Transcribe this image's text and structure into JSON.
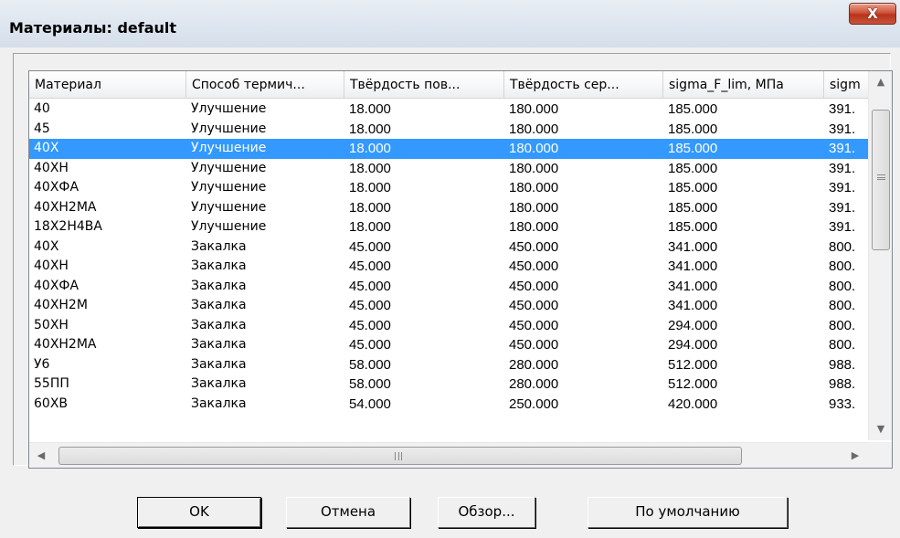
{
  "window": {
    "title": "Материалы: default",
    "close_label": "X"
  },
  "table": {
    "columns": [
      "Материал",
      "Способ термич...",
      "Твёрдость пов...",
      "Твёрдость сер...",
      "sigma_F_lim, МПа",
      "sigm"
    ],
    "selected_row": 2,
    "rows": [
      [
        "40",
        "Улучшение",
        "18.000",
        "180.000",
        "185.000",
        "391."
      ],
      [
        "45",
        "Улучшение",
        "18.000",
        "180.000",
        "185.000",
        "391."
      ],
      [
        "40Х",
        "Улучшение",
        "18.000",
        "180.000",
        "185.000",
        "391."
      ],
      [
        "40ХН",
        "Улучшение",
        "18.000",
        "180.000",
        "185.000",
        "391."
      ],
      [
        "40ХФА",
        "Улучшение",
        "18.000",
        "180.000",
        "185.000",
        "391."
      ],
      [
        "40ХН2МА",
        "Улучшение",
        "18.000",
        "180.000",
        "185.000",
        "391."
      ],
      [
        "18Х2Н4ВА",
        "Улучшение",
        "18.000",
        "180.000",
        "185.000",
        "391."
      ],
      [
        "40Х",
        "Закалка",
        "45.000",
        "450.000",
        "341.000",
        "800."
      ],
      [
        "40ХН",
        "Закалка",
        "45.000",
        "450.000",
        "341.000",
        "800."
      ],
      [
        "40ХФА",
        "Закалка",
        "45.000",
        "450.000",
        "341.000",
        "800."
      ],
      [
        "40ХН2М",
        "Закалка",
        "45.000",
        "450.000",
        "341.000",
        "800."
      ],
      [
        "50ХН",
        "Закалка",
        "45.000",
        "450.000",
        "294.000",
        "800."
      ],
      [
        "40ХН2МА",
        "Закалка",
        "45.000",
        "450.000",
        "294.000",
        "800."
      ],
      [
        "У6",
        "Закалка",
        "58.000",
        "280.000",
        "512.000",
        "988."
      ],
      [
        "55ПП",
        "Закалка",
        "58.000",
        "280.000",
        "512.000",
        "988."
      ],
      [
        "60ХВ",
        "Закалка",
        "54.000",
        "250.000",
        "420.000",
        "933."
      ]
    ]
  },
  "buttons": {
    "ok": "OK",
    "cancel": "Отмена",
    "browse": "Обзор...",
    "default": "По умолчанию"
  },
  "icons": {
    "scroll_up": "▲",
    "scroll_down": "▼",
    "scroll_left": "◀",
    "scroll_right": "▶"
  },
  "colors": {
    "selection": "#3399ff",
    "close_button": "#c9543c"
  }
}
